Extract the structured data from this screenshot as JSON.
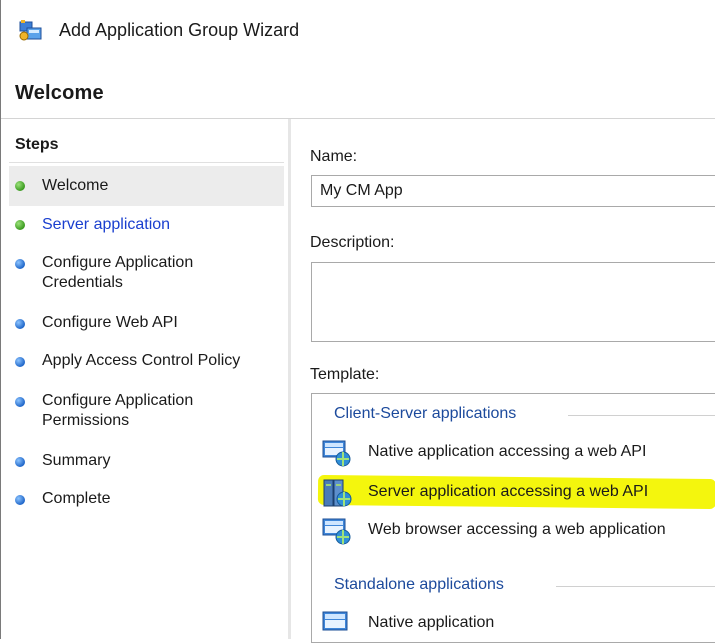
{
  "window": {
    "title": "Add Application Group Wizard",
    "icon": "application-group-icon"
  },
  "page": {
    "title": "Welcome"
  },
  "steps": {
    "title": "Steps",
    "items": [
      {
        "label": "Welcome",
        "status": "completed",
        "color": "#3a9a1f",
        "current": true
      },
      {
        "label": "Server application",
        "status": "next",
        "color": "#3a9a1f",
        "link": true
      },
      {
        "label": "Configure Application Credentials",
        "line1": "Configure Application",
        "line2": "Credentials",
        "status": "pending",
        "color": "#1f66c9"
      },
      {
        "label": "Configure Web API",
        "status": "pending",
        "color": "#1f66c9"
      },
      {
        "label": "Apply Access Control Policy",
        "status": "pending",
        "color": "#1f66c9"
      },
      {
        "label": "Configure Application Permissions",
        "line1": "Configure Application",
        "line2": "Permissions",
        "status": "pending",
        "color": "#1f66c9"
      },
      {
        "label": "Summary",
        "status": "pending",
        "color": "#1f66c9"
      },
      {
        "label": "Complete",
        "status": "pending",
        "color": "#1f66c9"
      }
    ]
  },
  "form": {
    "name_label": "Name:",
    "name_value": "My CM App",
    "description_label": "Description:",
    "description_value": "",
    "template_label": "Template:"
  },
  "template": {
    "groups": [
      {
        "header": "Client-Server applications",
        "items": [
          {
            "label": "Native application accessing a web API",
            "icon": "native-app-icon",
            "highlighted": false
          },
          {
            "label": "Server application accessing a web API",
            "icon": "server-app-icon",
            "highlighted": true
          },
          {
            "label": "Web browser accessing a web application",
            "icon": "web-browser-app-icon",
            "highlighted": false
          }
        ]
      },
      {
        "header": "Standalone applications",
        "items": [
          {
            "label": "Native application",
            "icon": "native-app-icon",
            "highlighted": false
          }
        ]
      }
    ]
  },
  "colors": {
    "group_header": "#1c4a9c",
    "link": "#1a3fcf",
    "highlight": "#f3f500",
    "current_step_bg": "#ececec"
  }
}
